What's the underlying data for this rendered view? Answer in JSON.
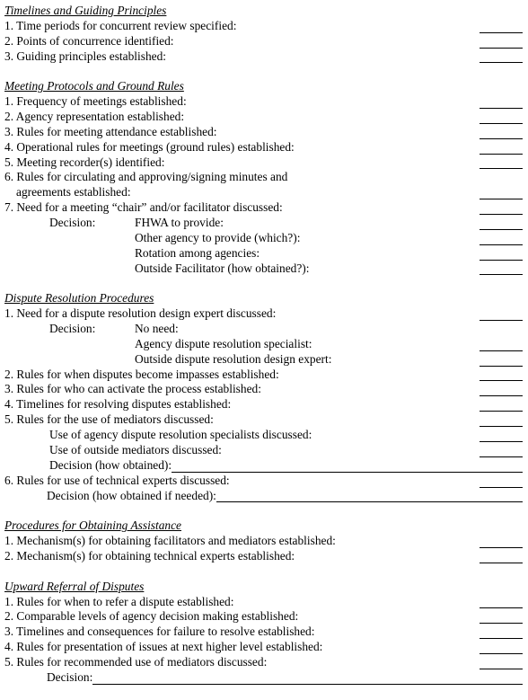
{
  "sections": [
    {
      "title": "Timelines and Guiding Principles",
      "rows": [
        {
          "text": "1. Time periods for concurrent review specified:",
          "indent": 0,
          "blank": "short"
        },
        {
          "text": "2. Points of concurrence identified:",
          "indent": 0,
          "blank": "short"
        },
        {
          "text": "3. Guiding principles established:",
          "indent": 0,
          "blank": "short"
        }
      ]
    },
    {
      "title": "Meeting Protocols and Ground Rules",
      "rows": [
        {
          "text": "1. Frequency of meetings established:",
          "indent": 0,
          "blank": "short"
        },
        {
          "text": "2. Agency representation established:",
          "indent": 0,
          "blank": "short"
        },
        {
          "text": "3. Rules for meeting attendance established:",
          "indent": 0,
          "blank": "short"
        },
        {
          "text": "4. Operational rules for meetings (ground rules) established:",
          "indent": 0,
          "blank": "short"
        },
        {
          "text": "5. Meeting recorder(s) identified:",
          "indent": 0,
          "blank": "short"
        },
        {
          "text": "6. Rules for circulating and approving/signing minutes and",
          "indent": 0,
          "blank": "none"
        },
        {
          "text": "agreements established:",
          "indent": 1,
          "blank": "short"
        },
        {
          "text": "7. Need for a meeting “chair” and/or facilitator discussed:",
          "indent": 0,
          "blank": "short"
        },
        {
          "label": "Decision:",
          "text": "FHWA to provide:",
          "indent": 3,
          "blank": "short"
        },
        {
          "text": "Other agency to provide (which?):",
          "indent": 3,
          "blank": "short"
        },
        {
          "text": "Rotation among agencies:",
          "indent": 3,
          "blank": "short"
        },
        {
          "text": "Outside Facilitator (how obtained?):",
          "indent": 3,
          "blank": "short"
        }
      ]
    },
    {
      "title": "Dispute Resolution Procedures",
      "rows": [
        {
          "text": "1. Need for a dispute resolution design expert discussed:",
          "indent": 0,
          "blank": "short"
        },
        {
          "label": "Decision:",
          "text": "No need:",
          "indent": 3,
          "blank": "none"
        },
        {
          "text": "Agency dispute resolution specialist:",
          "indent": 3,
          "blank": "short"
        },
        {
          "text": "Outside dispute resolution design expert:",
          "indent": 3,
          "blank": "short"
        },
        {
          "text": "2. Rules for when disputes become impasses established:",
          "indent": 0,
          "blank": "short"
        },
        {
          "text": "3. Rules for who can activate the process established:",
          "indent": 0,
          "blank": "short"
        },
        {
          "text": "4. Timelines for resolving disputes established:",
          "indent": 0,
          "blank": "short"
        },
        {
          "text": "5. Rules for the use of mediators discussed:",
          "indent": 0,
          "blank": "short"
        },
        {
          "text": "Use of agency dispute resolution specialists discussed:",
          "indent": 2,
          "blank": "short"
        },
        {
          "text": "Use of outside mediators discussed:",
          "indent": 2,
          "blank": "short"
        },
        {
          "text": "Decision (how obtained):",
          "indent": 2,
          "blank": "fill"
        },
        {
          "text": "6. Rules for use of technical experts discussed:",
          "indent": 0,
          "blank": "short"
        },
        {
          "text": "Decision (how obtained if needed):",
          "indent": 4,
          "blank": "fill"
        }
      ]
    },
    {
      "title": "Procedures for Obtaining Assistance",
      "rows": [
        {
          "text": "1. Mechanism(s) for obtaining facilitators and mediators established:",
          "indent": 0,
          "blank": "short"
        },
        {
          "text": "2. Mechanism(s) for obtaining technical experts established:",
          "indent": 0,
          "blank": "short"
        }
      ]
    },
    {
      "title": "Upward Referral of Disputes",
      "rows": [
        {
          "text": "1. Rules for when to refer a dispute established:",
          "indent": 0,
          "blank": "short"
        },
        {
          "text": "2. Comparable levels of agency decision making established:",
          "indent": 0,
          "blank": "short"
        },
        {
          "text": "3. Timelines and consequences for failure to resolve established:",
          "indent": 0,
          "blank": "short"
        },
        {
          "text": "4. Rules for presentation of issues at next higher level established:",
          "indent": 0,
          "blank": "short"
        },
        {
          "text": "5. Rules for recommended use of mediators discussed:",
          "indent": 0,
          "blank": "short"
        },
        {
          "text": "Decision:",
          "indent": 4,
          "blank": "fill"
        }
      ]
    }
  ]
}
